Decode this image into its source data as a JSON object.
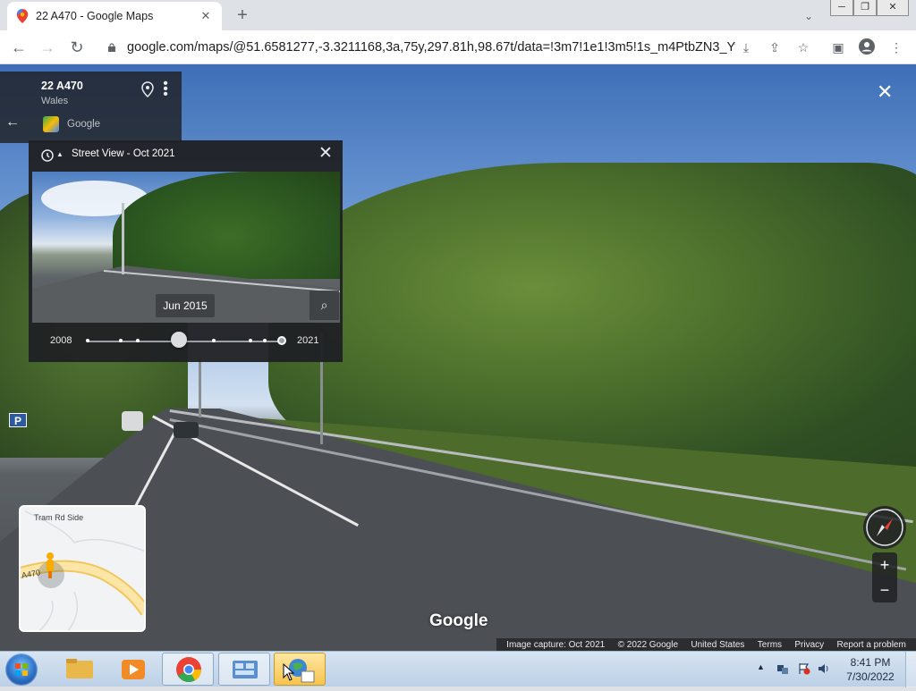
{
  "browser": {
    "tab_title": "22 A470 - Google Maps",
    "new_tab": "+",
    "url": "google.com/maps/@51.6581277,-3.3211168,3a,75y,297.81h,98.67t/data=!3m7!1e1!3m5!1s_m4PtbZN3_YvF...",
    "window_controls": [
      "─",
      "❐",
      "✕"
    ]
  },
  "place": {
    "title": "22 A470",
    "subtitle": "Wales",
    "source": "Google"
  },
  "timeline": {
    "title": "Street View - Oct 2021",
    "tooltip": "Jun 2015",
    "year_start": "2008",
    "year_end": "2021",
    "selected_fraction": 0.47
  },
  "minimap": {
    "road_label_1": "Tram Rd Side",
    "road_label_2": "A470"
  },
  "watermark": "Google",
  "attribution": {
    "capture": "Image capture: Oct 2021",
    "copyright": "© 2022 Google",
    "region": "United States",
    "terms": "Terms",
    "privacy": "Privacy",
    "report": "Report a problem"
  },
  "taskbar": {
    "time": "8:41 PM",
    "date": "7/30/2022"
  },
  "colors": {
    "panel_bg": "#202124",
    "taskbar_bg": "#bcd0e6",
    "chrome_tab_bar": "#dee1e6"
  }
}
